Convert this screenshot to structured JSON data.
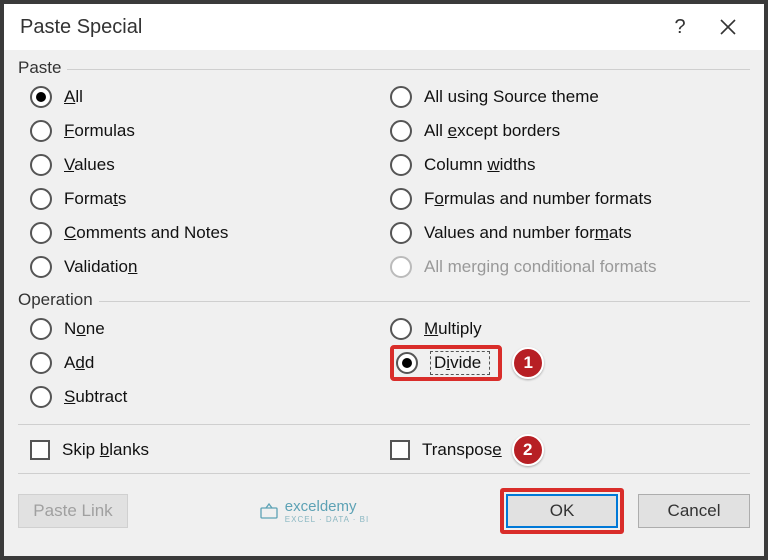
{
  "titlebar": {
    "title": "Paste Special"
  },
  "paste": {
    "header": "Paste",
    "left": [
      {
        "label": "All",
        "underline": [
          0,
          1
        ],
        "checked": true
      },
      {
        "label": "Formulas",
        "underline": [
          0,
          1
        ]
      },
      {
        "label": "Values",
        "underline": [
          0,
          1
        ]
      },
      {
        "label": "Formats",
        "underline": [
          5,
          6
        ]
      },
      {
        "label": "Comments and Notes",
        "underline": [
          0,
          1
        ]
      },
      {
        "label": "Validation",
        "underline": [
          9,
          10
        ]
      }
    ],
    "right": [
      {
        "label": "All using Source theme"
      },
      {
        "label": "All except borders",
        "underline": [
          4,
          5
        ]
      },
      {
        "label": "Column widths",
        "underline": [
          7,
          8
        ]
      },
      {
        "label": "Formulas and number formats",
        "underline": [
          1,
          2
        ]
      },
      {
        "label": "Values and number formats",
        "underline": [
          21,
          22
        ]
      },
      {
        "label": "All merging conditional formats",
        "disabled": true
      }
    ]
  },
  "operation": {
    "header": "Operation",
    "left": [
      {
        "label": "None",
        "underline": [
          1,
          2
        ]
      },
      {
        "label": "Add",
        "underline": [
          1,
          2
        ]
      },
      {
        "label": "Subtract",
        "underline": [
          0,
          1
        ]
      }
    ],
    "right": [
      {
        "label": "Multiply",
        "underline": [
          0,
          1
        ]
      },
      {
        "label": "Divide",
        "underline": [
          1,
          2
        ],
        "checked": true,
        "focus": true,
        "highlight": true,
        "badge": "1"
      }
    ]
  },
  "checks": {
    "skip": {
      "label": "Skip blanks",
      "underline": [
        5,
        6
      ]
    },
    "transpose": {
      "label": "Transpose",
      "underline": [
        8,
        9
      ],
      "badge": "2"
    }
  },
  "buttons": {
    "paste_link": "Paste Link",
    "ok": "OK",
    "cancel": "Cancel"
  },
  "logo": {
    "name": "exceldemy",
    "tag": "EXCEL · DATA · BI"
  }
}
